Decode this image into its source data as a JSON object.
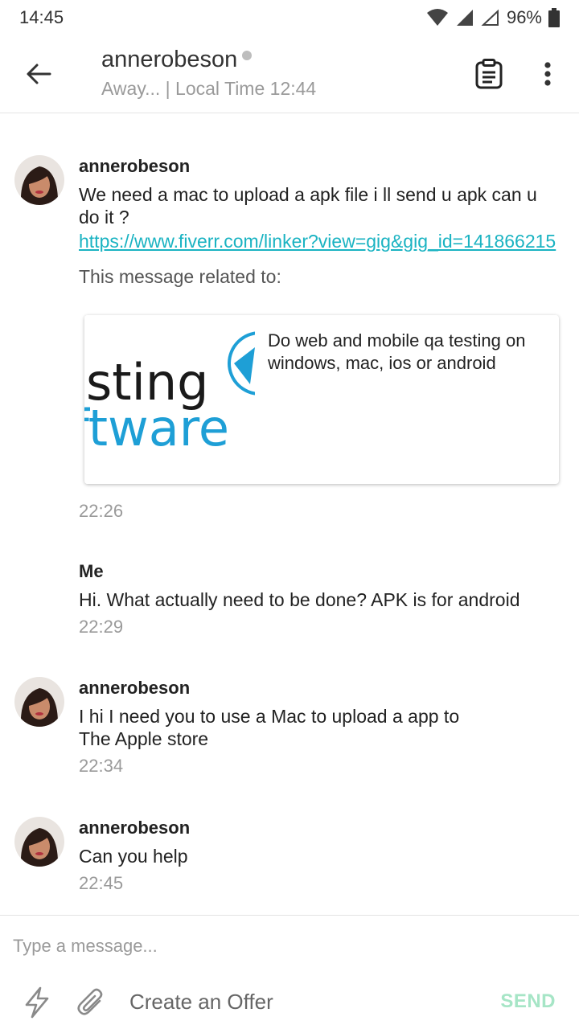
{
  "status_bar": {
    "time": "14:45",
    "battery": "96%",
    "icons": [
      "wifi-icon",
      "signal-icon",
      "signal-empty-icon",
      "battery-icon"
    ]
  },
  "header": {
    "username": "annerobeson",
    "status": "Away... | Local Time 12:44",
    "icons": [
      "back-arrow-icon",
      "clipboard-icon",
      "more-vert-icon"
    ]
  },
  "messages": [
    {
      "sender": "annerobeson",
      "text": "We need a mac to upload a apk file i ll send u apk can u do it ?",
      "link": "https://www.fiverr.com/linker?view=gig&gig_id=141866215",
      "related_label": "This message related to:",
      "gig": {
        "title": "Do web and mobile qa testing on windows, mac, ios or android",
        "thumb_line1": "sting",
        "thumb_line2": "ftware"
      },
      "time": "22:26"
    },
    {
      "sender": "Me",
      "text": "Hi. What actually need to be done? APK is for android",
      "time": "22:29"
    },
    {
      "sender": "annerobeson",
      "text_line1": "I hi I need you to use a Mac to upload a app to",
      "text_line2": "The Apple store",
      "time": "22:34"
    },
    {
      "sender": "annerobeson",
      "text": "Can you help",
      "time": "22:45"
    }
  ],
  "composer": {
    "placeholder": "Type a message...",
    "offer_label": "Create an Offer",
    "send_label": "SEND",
    "icons": [
      "bolt-icon",
      "paperclip-icon"
    ]
  },
  "colors": {
    "link": "#1ab3c2",
    "send_disabled": "#a6e5c6",
    "thumb_dark": "#1a1a1a",
    "thumb_blue": "#1e9fd6"
  }
}
